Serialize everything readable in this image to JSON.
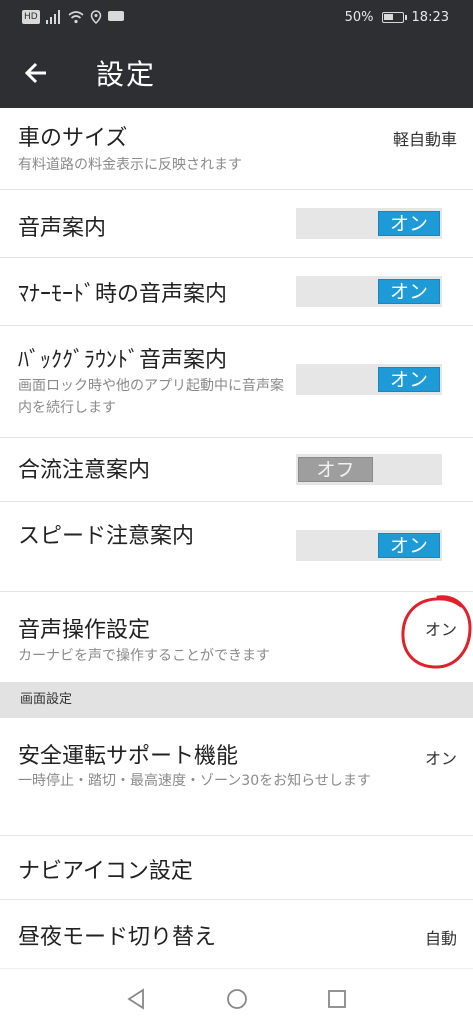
{
  "status_bar": {
    "left_badge": "HD",
    "battery_text": "50%",
    "battery_level": 0.5,
    "time": "18:23"
  },
  "app_bar": {
    "back_icon": "arrow-left-icon",
    "title": "設定"
  },
  "settings": {
    "car_size": {
      "title": "車のサイズ",
      "subtitle": "有料道路の料金表示に反映されます",
      "value": "軽自動車"
    },
    "voice_guidance": {
      "title": "音声案内",
      "state": "オン"
    },
    "manner_mode_voice": {
      "title": "ﾏﾅｰﾓｰﾄﾞ時の音声案内",
      "state": "オン"
    },
    "background_voice": {
      "title": "ﾊﾞｯｸｸﾞﾗｳﾝﾄﾞ音声案内",
      "subtitle": "画面ロック時や他のアプリ起動中に音声案内を続行します",
      "state": "オン"
    },
    "merge_warning": {
      "title": "合流注意案内",
      "state": "オフ"
    },
    "speed_warning": {
      "title": "スピード注意案内",
      "state": "オン"
    },
    "voice_operation": {
      "title": "音声操作設定",
      "subtitle": "カーナビを声で操作することができます",
      "value": "オン"
    }
  },
  "screen_section": {
    "header": "画面設定",
    "safe_driving": {
      "title": "安全運転サポート機能",
      "subtitle": "一時停止・踏切・最高速度・ゾーン30をお知らせします",
      "value": "オン"
    },
    "navi_icon": {
      "title": "ナビアイコン設定"
    },
    "day_night": {
      "title": "昼夜モード切り替え",
      "value": "自動"
    }
  },
  "nav_bar": {
    "back": "triangle-back-icon",
    "home": "circle-home-icon",
    "recents": "square-recents-icon"
  },
  "colors": {
    "app_bar": "#2d2f33",
    "toggle_on": "#1e9bd7",
    "toggle_off": "#9e9e9e",
    "annotation_circle": "#e0202a"
  }
}
